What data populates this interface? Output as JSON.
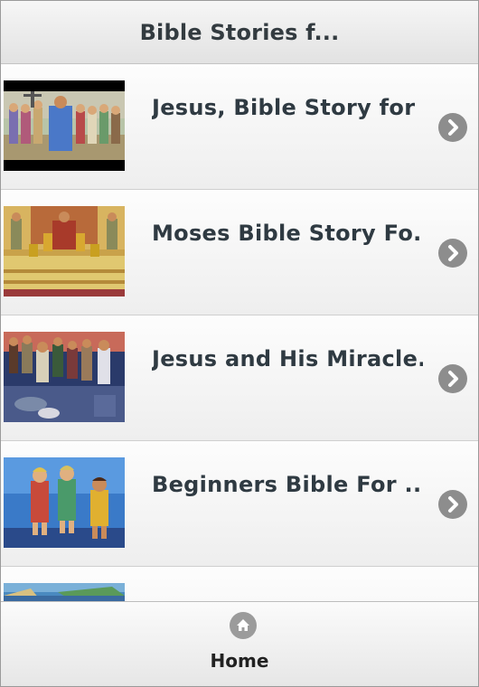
{
  "header": {
    "title": "Bible Stories f..."
  },
  "items": [
    {
      "title": "Jesus, Bible Story for ...",
      "thumb": "jesus-crowd-thumbnail"
    },
    {
      "title": "Moses Bible Story Fo...",
      "thumb": "pharaoh-throne-thumbnail"
    },
    {
      "title": "Jesus and His Miracle...",
      "thumb": "miracle-crowd-thumbnail"
    },
    {
      "title": "Beginners Bible For ...",
      "thumb": "children-group-thumbnail"
    },
    {
      "title": "",
      "thumb": "sea-scene-thumbnail"
    }
  ],
  "footer": {
    "home_label": "Home",
    "home_icon": "home-icon"
  },
  "colors": {
    "title_text": "#2f3a42",
    "chevron_bg": "#8d8d8d",
    "icon_bg": "#9b9b9b"
  }
}
